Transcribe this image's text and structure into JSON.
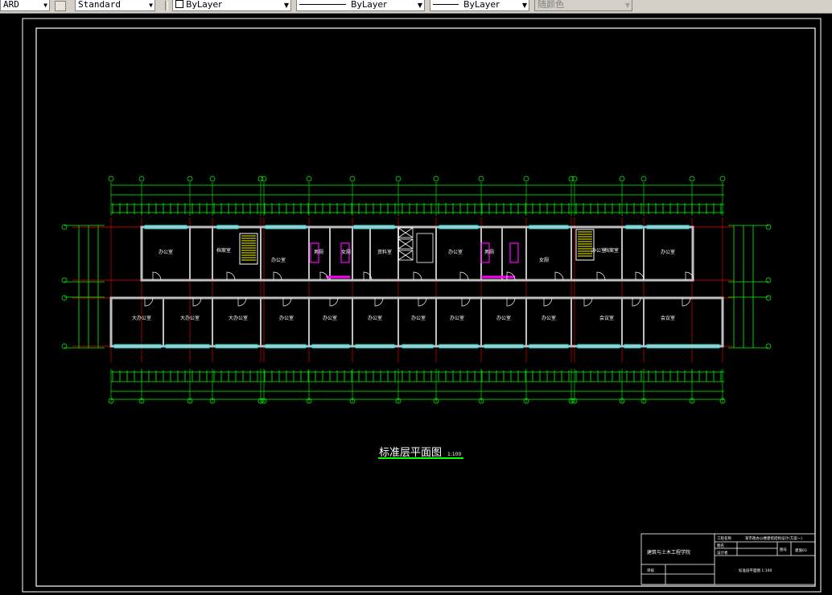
{
  "toolbar": {
    "text_style_partial": "ARD",
    "dim_style": "Standard",
    "layer": "ByLayer",
    "linetype": "ByLayer",
    "lineweight": "ByLayer",
    "plot_style": "随颜色"
  },
  "drawing": {
    "plan_title": "标准层平面图",
    "plan_scale": "1:100",
    "rooms_upper": [
      "办公室",
      "档案室",
      "办公室",
      "男厕",
      "女厕",
      "资料室",
      "办公室",
      "男厕",
      "女厕",
      "办公室",
      "档案室",
      "办公室"
    ],
    "rooms_lower": [
      "大办公室",
      "大办公室",
      "大办公室",
      "办公室",
      "办公室",
      "办公室",
      "办公室",
      "办公室",
      "办公室",
      "办公室",
      "会议室",
      "会议室"
    ],
    "title_block": {
      "school": "建筑与土木工程学院",
      "project_label": "工程名称",
      "project_value": "某市政办公楼建筑结构设计(方案一)",
      "title_label": "图名",
      "designer_label": "设计者",
      "sheet_label": "图号",
      "sheet_value": "建施03",
      "checker_label": "审核",
      "drawing_name": "标准层平面图 1:100"
    }
  },
  "colors": {
    "axis_green": "#00ff00",
    "wall_red": "#ff0000",
    "window_cyan": "#00ffff",
    "door_white": "#ffffff",
    "stair_yellow": "#ffff00",
    "fixture_magenta": "#ff00ff"
  }
}
